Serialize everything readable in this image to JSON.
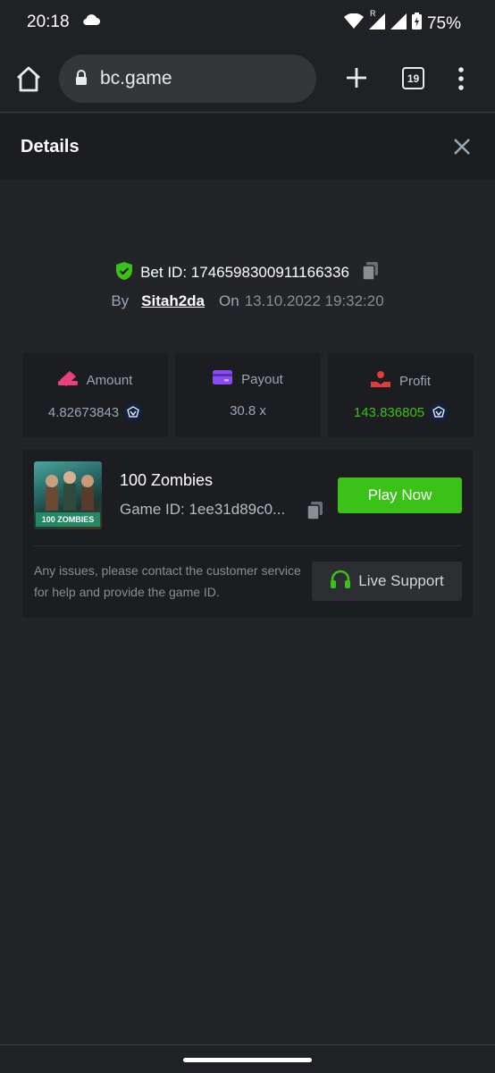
{
  "status_bar": {
    "time": "20:18",
    "battery": "75%",
    "network_label": "R"
  },
  "browser": {
    "url": "bc.game",
    "tab_count": "19"
  },
  "dialog": {
    "title": "Details"
  },
  "bet": {
    "id_label": "Bet ID: 1746598300911166336",
    "by_label": "By",
    "user": "Sitah2da",
    "on_label": "On",
    "datetime": "13.10.2022 19:32:20"
  },
  "stats": [
    {
      "label": "Amount",
      "value": "4.82673843",
      "icon": "amount-icon",
      "color": "#e8427c",
      "coin": true,
      "value_color": "#98a7b5"
    },
    {
      "label": "Payout",
      "value": "30.8 x",
      "icon": "payout-icon",
      "color": "#8a4cf0",
      "coin": false,
      "value_color": "#98a7b5"
    },
    {
      "label": "Profit",
      "value": "143.836805",
      "icon": "profit-icon",
      "color": "#e33b3b",
      "coin": true,
      "value_color": "#3bc117"
    }
  ],
  "game": {
    "thumb_label": "100 ZOMBIES",
    "name": "100 Zombies",
    "id_label": "Game ID: 1ee31d89c0...",
    "play_label": "Play Now",
    "issue_text": "Any issues, please contact the customer service for help and provide the game ID.",
    "support_label": "Live Support"
  },
  "colors": {
    "accent_green": "#3bc117",
    "background": "#232427",
    "card": "#1c1d20"
  }
}
